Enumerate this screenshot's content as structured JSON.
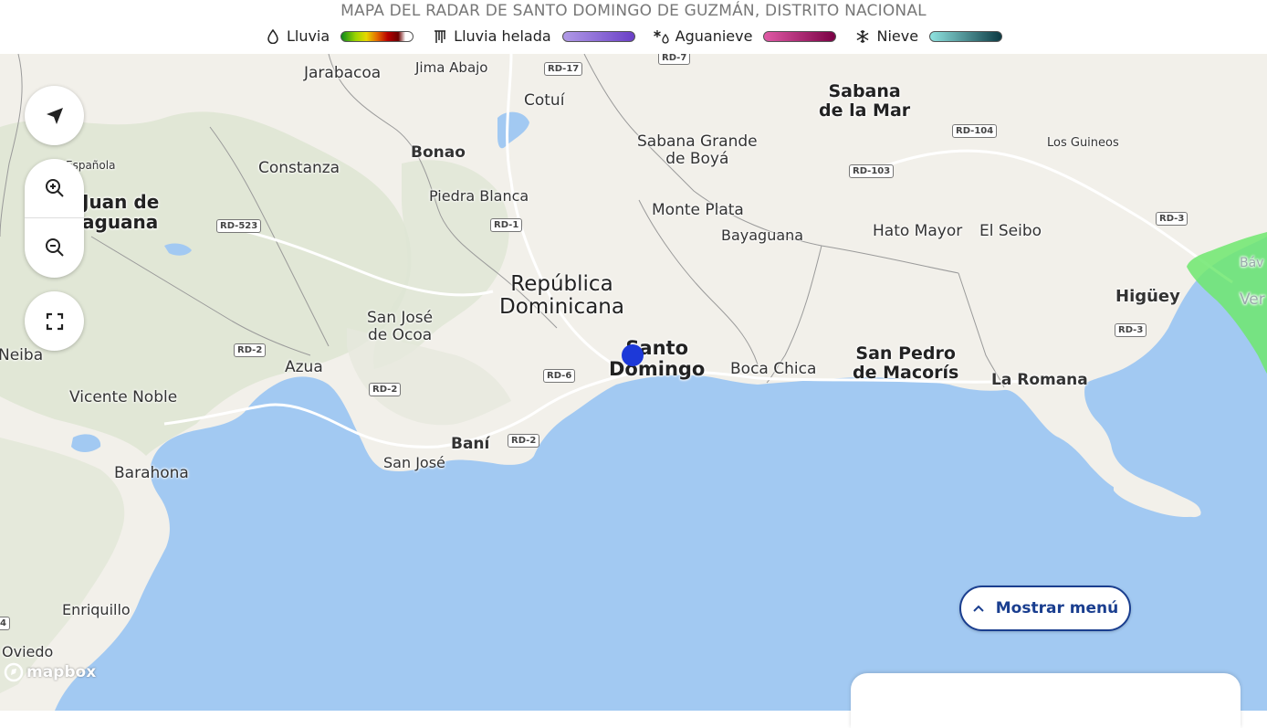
{
  "header": {
    "title": "MAPA DEL RADAR DE SANTO DOMINGO DE GUZMÁN, DISTRITO NACIONAL",
    "legend": [
      {
        "icon": "raindrop-icon",
        "label": "Lluvia",
        "gradient": [
          "#0b8a1b",
          "#e6e600",
          "#e36b00",
          "#b80000",
          "#6b0000",
          "#ffffff"
        ]
      },
      {
        "icon": "freezing-rain-icon",
        "label": "Lluvia helada",
        "gradient": [
          "#b09ae6",
          "#6a3fc7"
        ]
      },
      {
        "icon": "sleet-icon",
        "label": "Aguanieve",
        "gradient": [
          "#e05aa6",
          "#7a0044"
        ]
      },
      {
        "icon": "snowflake-icon",
        "label": "Nieve",
        "gradient": [
          "#8fe3e0",
          "#0c3a44"
        ]
      }
    ]
  },
  "map": {
    "colors": {
      "sea": "#a2c9f2",
      "land": "#f2f0ea",
      "terrain": "#dfe6d4",
      "radar": "#6fe86f",
      "location": "#1d39d8"
    },
    "places": [
      {
        "name": "Jarabacoa"
      },
      {
        "name": "Jima Abajo"
      },
      {
        "name": "Cotuí"
      },
      {
        "name": "Sabana\nde la Mar"
      },
      {
        "name": "Los Guineos"
      },
      {
        "name": "Española"
      },
      {
        "name": "Constanza"
      },
      {
        "name": "Bonao"
      },
      {
        "name": "Sabana Grande\nde Boyá"
      },
      {
        "name": "Juan de\naguana"
      },
      {
        "name": "Piedra Blanca"
      },
      {
        "name": "Monte Plata"
      },
      {
        "name": "Bayaguana"
      },
      {
        "name": "Hato Mayor"
      },
      {
        "name": "El Seibo"
      },
      {
        "name": "República\nDominicana"
      },
      {
        "name": "Higüey"
      },
      {
        "name": "San José\nde Ocoa"
      },
      {
        "name": "Neiba"
      },
      {
        "name": "Azua"
      },
      {
        "name": "Santo\nDomingo"
      },
      {
        "name": "Boca Chica"
      },
      {
        "name": "San Pedro\nde Macorís"
      },
      {
        "name": "La Romana"
      },
      {
        "name": "Vicente Noble"
      },
      {
        "name": "Baní"
      },
      {
        "name": "San José"
      },
      {
        "name": "Barahona"
      },
      {
        "name": "Enriquillo"
      },
      {
        "name": "Oviedo"
      },
      {
        "name": "Báv"
      },
      {
        "name": "Ver"
      }
    ],
    "roads": [
      "RD-7",
      "RD-17",
      "RD-104",
      "RD-103",
      "RD-1",
      "RD-523",
      "RD-3",
      "RD-2",
      "RD-6",
      "RD-2",
      "RD-2",
      "RD-3",
      "4"
    ],
    "attribution": "mapbox"
  },
  "controls": {
    "locate": "navigate-arrow-icon",
    "zoom_in": "zoom-in-icon",
    "zoom_out": "zoom-out-icon",
    "fullscreen": "fullscreen-icon"
  },
  "menu_button": {
    "label": "Mostrar menú",
    "icon": "chevron-up-icon"
  }
}
